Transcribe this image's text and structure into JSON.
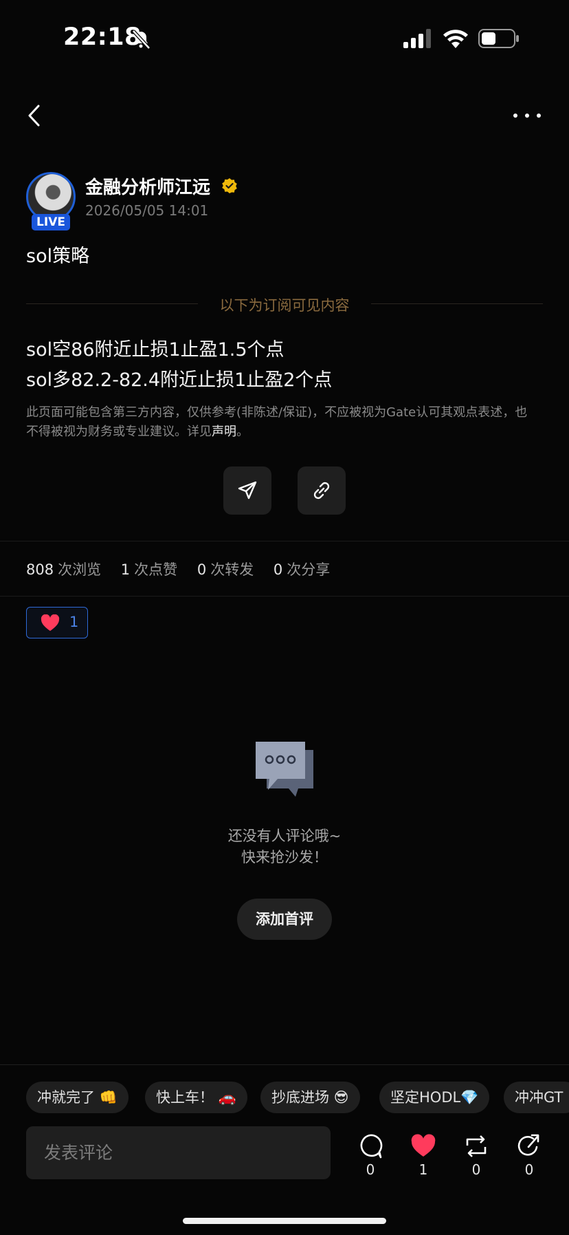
{
  "status_bar": {
    "time": "22:18"
  },
  "author": {
    "name": "金融分析师江远",
    "date": "2026/05/05 14:01",
    "live_badge": "LIVE"
  },
  "post": {
    "title": "sol策略",
    "divider": "以下为订阅可见内容",
    "lines": [
      "sol空86附近止损1止盈1.5个点",
      "sol多82.2-82.4附近止损1止盈2个点"
    ],
    "disclaimer_text": "此页面可能包含第三方内容，仅供参考(非陈述/保证)，不应被视为Gate认可其观点表述，也不得被视为财务或专业建议。详见",
    "disclaimer_link": "声明",
    "disclaimer_end": "。"
  },
  "stats": {
    "views": "808",
    "views_label": "次浏览",
    "likes": "1",
    "likes_label": "次点赞",
    "reposts": "0",
    "reposts_label": "次转发",
    "shares": "0",
    "shares_label": "次分享"
  },
  "reaction": {
    "count": "1"
  },
  "empty_state": {
    "line1": "还没有人评论哦~",
    "line2": "快来抢沙发！",
    "button": "添加首评"
  },
  "quick_replies": [
    "冲就完了 👊",
    "快上车！ 🚗",
    "抄底进场 😎",
    "坚定HODL💎",
    "冲冲GT"
  ],
  "comment_input": {
    "placeholder": "发表评论"
  },
  "bottom_actions": {
    "comments": "0",
    "likes": "1",
    "reposts": "0",
    "shares": "0"
  },
  "colors": {
    "accent_blue": "#1a56db",
    "gold": "#8a6a3e",
    "like_red": "#ff3b5c"
  },
  "icons": [
    "bell-slash-icon",
    "signal-icon",
    "wifi-icon",
    "battery-icon",
    "back-arrow-icon",
    "more-icon",
    "verified-icon",
    "send-icon",
    "link-icon",
    "heart-icon",
    "chat-bubbles-icon",
    "comment-icon",
    "repost-icon",
    "share-icon"
  ]
}
